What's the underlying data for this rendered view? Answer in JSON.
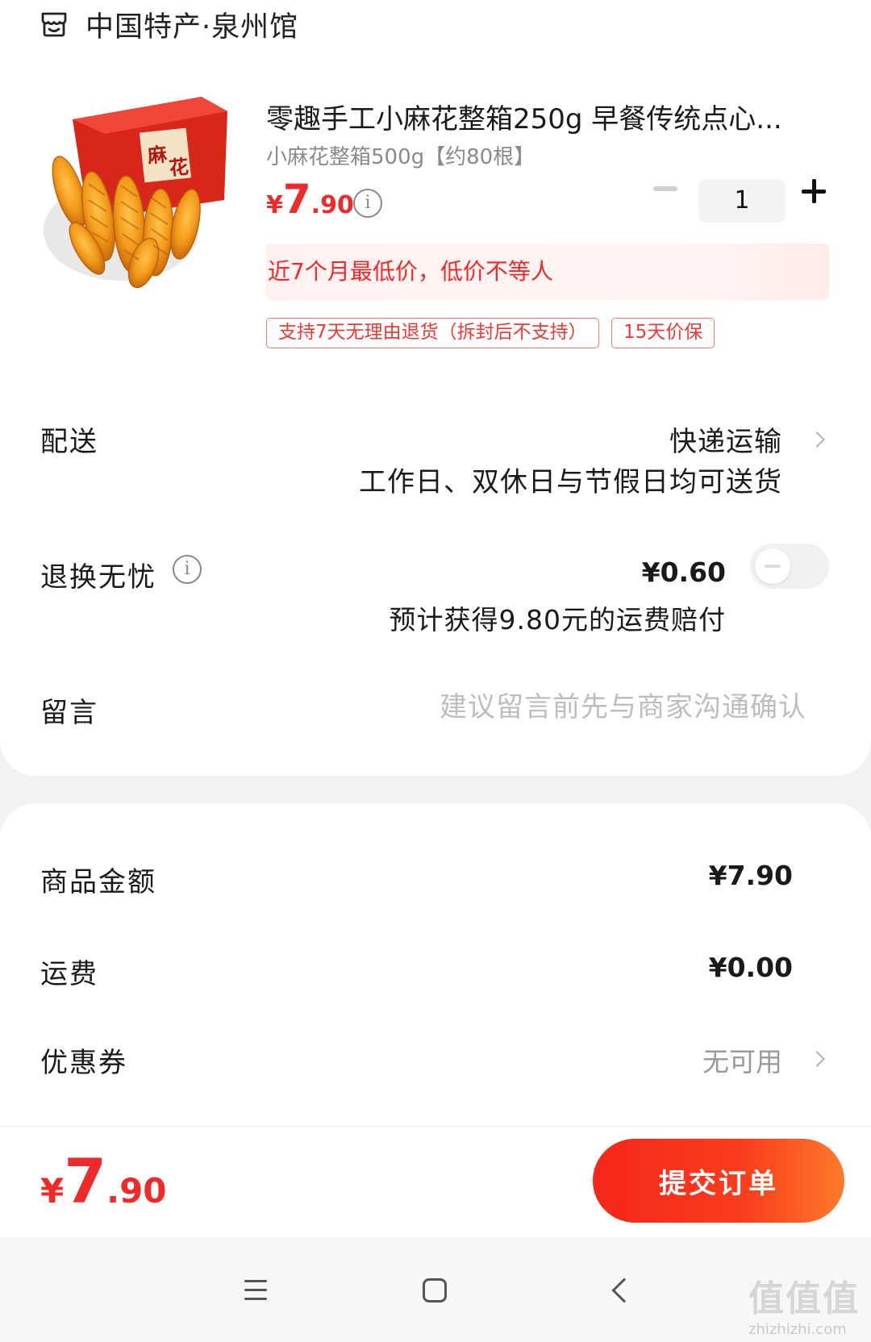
{
  "shop": {
    "name": "中国特产·泉州馆",
    "icon": "shop-icon"
  },
  "product": {
    "title": "零趣手工小麻花整箱250g 早餐传统点心...",
    "spec": "小麻花整箱500g【约80根】",
    "price": {
      "symbol": "¥",
      "int": "7",
      "dec": ".90"
    },
    "price_info_icon": "info-icon",
    "quantity": "1",
    "low_price_notice": "近7个月最低价，低价不等人",
    "tags": [
      "支持7天无理由退货（拆封后不支持）",
      "15天价保"
    ]
  },
  "delivery": {
    "label": "配送",
    "method": "快递运输",
    "note": "工作日、双休日与节假日均可送货"
  },
  "return_service": {
    "label": "退换无忧",
    "price": "¥0.60",
    "note": "预计获得9.80元的运费赔付",
    "enabled": false
  },
  "message": {
    "label": "留言",
    "placeholder": "建议留言前先与商家沟通确认",
    "value": ""
  },
  "summary": {
    "goods_label": "商品金额",
    "goods_value": "¥7.90",
    "shipping_label": "运费",
    "shipping_value": "¥0.00",
    "coupon_label": "优惠券",
    "coupon_value": "无可用"
  },
  "footer": {
    "total": {
      "symbol": "¥",
      "int": "7",
      "dec": ".90"
    },
    "submit_label": "提交订单"
  },
  "watermark": {
    "big": "值值值",
    "small": "zhizhizhi.com"
  },
  "colors": {
    "accent": "#ee2a2a",
    "button_start": "#f5261a",
    "button_end": "#fd7a2a"
  }
}
